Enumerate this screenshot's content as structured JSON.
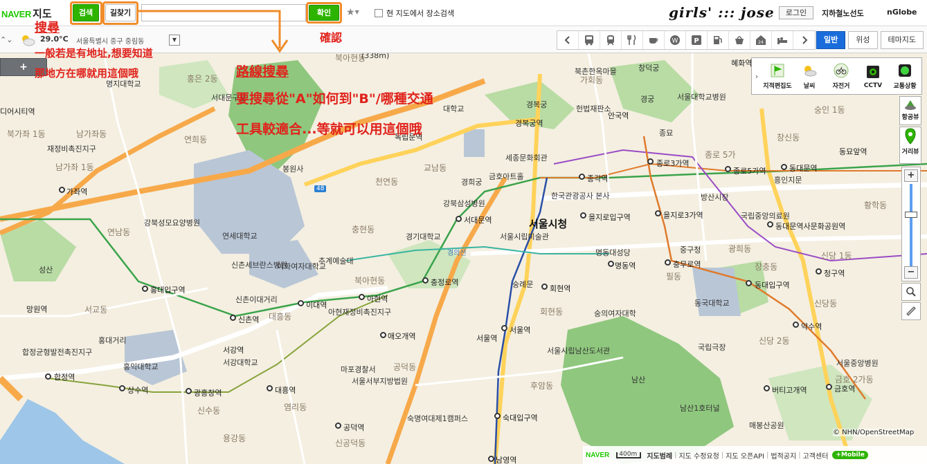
{
  "header": {
    "logo_naver": "NAVER",
    "logo_map": "지도",
    "search_button": "검색",
    "route_button": "길찾기",
    "search_value": "",
    "confirm_button": "확인",
    "nearby_search_label": "현 지도에서 장소검색",
    "blog_signature": "girls' ::: jose",
    "login_button": "로그인",
    "subway_link": "지하철노선도",
    "nglobe_link": "nGlobe"
  },
  "subbar": {
    "temperature": "29.0°C",
    "location": "서울특별시 중구 중림동",
    "tabs": [
      {
        "label": "일반",
        "active": true
      },
      {
        "label": "위성",
        "active": false
      },
      {
        "label": "테마지도",
        "active": false
      }
    ],
    "poi_icons": [
      "prev-arrow-icon",
      "bus-icon",
      "subway-icon",
      "restaurant-icon",
      "cafe-icon",
      "bank-icon",
      "parking-icon",
      "gas-station-icon",
      "shopping-icon",
      "convenience-store-icon",
      "hotel-icon",
      "next-arrow-icon"
    ]
  },
  "map": {
    "add_button": "+",
    "layers": [
      {
        "label": "지적편집도",
        "icon": "cadastral-flag-icon"
      },
      {
        "label": "날씨",
        "icon": "weather-icon"
      },
      {
        "label": "자전거",
        "icon": "bicycle-icon"
      },
      {
        "label": "CCTV",
        "icon": "cctv-icon"
      },
      {
        "label": "교통상황",
        "icon": "traffic-light-icon"
      }
    ],
    "aerial_view": "항공뷰",
    "street_view": "거리뷰",
    "big_label": "서울시청",
    "labels": [
      {
        "t": "북아현동",
        "c": "dong"
      },
      {
        "t": "혜화역",
        "c": "station"
      },
      {
        "t": "명지대학교",
        "c": ""
      },
      {
        "t": "홍은 2동",
        "c": "dong"
      },
      {
        "t": "서대문구청",
        "c": ""
      },
      {
        "t": "북촌한옥마을",
        "c": ""
      },
      {
        "t": "창덕궁",
        "c": ""
      },
      {
        "t": "가회동",
        "c": "dong"
      },
      {
        "t": "디어시티역",
        "c": "station"
      },
      {
        "t": "대학교",
        "c": ""
      },
      {
        "t": "경복궁",
        "c": ""
      },
      {
        "t": "헌법재판소",
        "c": ""
      },
      {
        "t": "서울대학교병원",
        "c": ""
      },
      {
        "t": "경궁",
        "c": ""
      },
      {
        "t": "숭인 1동",
        "c": "dong"
      },
      {
        "t": "북가좌 1동",
        "c": "dong"
      },
      {
        "t": "연희동",
        "c": "dong"
      },
      {
        "t": "안국역",
        "c": "station"
      },
      {
        "t": "경복궁역",
        "c": "station"
      },
      {
        "t": "종묘",
        "c": ""
      },
      {
        "t": "남가좌동",
        "c": "dong"
      },
      {
        "t": "재정비촉진지구",
        "c": ""
      },
      {
        "t": "독립문역",
        "c": "station"
      },
      {
        "t": "창신동",
        "c": "dong"
      },
      {
        "t": "남가좌 1동",
        "c": "dong"
      },
      {
        "t": "봉원사",
        "c": ""
      },
      {
        "t": "세종문화회관",
        "c": ""
      },
      {
        "t": "종로3가역",
        "c": "station"
      },
      {
        "t": "종로 5가",
        "c": "dong"
      },
      {
        "t": "동묘앞역",
        "c": "station"
      },
      {
        "t": "가좌역",
        "c": "station"
      },
      {
        "t": "교남동",
        "c": "dong"
      },
      {
        "t": "경희궁",
        "c": ""
      },
      {
        "t": "금호아트홀",
        "c": ""
      },
      {
        "t": "종각역",
        "c": "station"
      },
      {
        "t": "종로5가역",
        "c": "station"
      },
      {
        "t": "동대문역",
        "c": "station"
      },
      {
        "t": "흥인지문",
        "c": ""
      },
      {
        "t": "천연동",
        "c": "dong"
      },
      {
        "t": "강북삼성병원",
        "c": ""
      },
      {
        "t": "한국관광공사 본사",
        "c": ""
      },
      {
        "t": "방산시장",
        "c": ""
      },
      {
        "t": "황학동",
        "c": "dong"
      },
      {
        "t": "강북성모요양병원",
        "c": ""
      },
      {
        "t": "서대문역",
        "c": "station"
      },
      {
        "t": "을지로입구역",
        "c": "station"
      },
      {
        "t": "을지로3가역",
        "c": "station"
      },
      {
        "t": "국립중앙의료원",
        "c": ""
      },
      {
        "t": "동대문역사문화공원역",
        "c": "station"
      },
      {
        "t": "충현동",
        "c": "dong"
      },
      {
        "t": "연세대학교",
        "c": ""
      },
      {
        "t": "경기대학교",
        "c": ""
      },
      {
        "t": "서울시립미술관",
        "c": ""
      },
      {
        "t": "중구청",
        "c": ""
      },
      {
        "t": "광희동",
        "c": "dong"
      },
      {
        "t": "연남동",
        "c": "dong"
      },
      {
        "t": "신촌세브란스병원",
        "c": ""
      },
      {
        "t": "이화여자대학교",
        "c": ""
      },
      {
        "t": "추계예술대",
        "c": ""
      },
      {
        "t": "명동대성당",
        "c": ""
      },
      {
        "t": "명동역",
        "c": "station"
      },
      {
        "t": "충무로역",
        "c": "station"
      },
      {
        "t": "장충동",
        "c": "dong"
      },
      {
        "t": "신당 1동",
        "c": "dong"
      },
      {
        "t": "청구역",
        "c": "station"
      },
      {
        "t": "성산",
        "c": ""
      },
      {
        "t": "홍대입구역",
        "c": "station"
      },
      {
        "t": "북아현동",
        "c": "dong"
      },
      {
        "t": "충정로역",
        "c": "station"
      },
      {
        "t": "숭례문",
        "c": ""
      },
      {
        "t": "회현역",
        "c": "station"
      },
      {
        "t": "필동",
        "c": "dong"
      },
      {
        "t": "동대입구역",
        "c": "station"
      },
      {
        "t": "동국대학교",
        "c": ""
      },
      {
        "t": "망원역",
        "c": "station"
      },
      {
        "t": "신촌이대거리",
        "c": ""
      },
      {
        "t": "이대역",
        "c": "station"
      },
      {
        "t": "아현역",
        "c": "station"
      },
      {
        "t": "회현동",
        "c": "dong"
      },
      {
        "t": "숭의여자대학",
        "c": ""
      },
      {
        "t": "신당동",
        "c": "dong"
      },
      {
        "t": "서교동",
        "c": "dong"
      },
      {
        "t": "신촌역",
        "c": "station"
      },
      {
        "t": "대흥동",
        "c": "dong"
      },
      {
        "t": "아현재정비촉진지구",
        "c": ""
      },
      {
        "t": "서울역",
        "c": "station"
      },
      {
        "t": "약수역",
        "c": "station"
      },
      {
        "t": "홍대거리",
        "c": ""
      },
      {
        "t": "애오개역",
        "c": "station"
      },
      {
        "t": "서울시립남산도서관",
        "c": ""
      },
      {
        "t": "국립극장",
        "c": ""
      },
      {
        "t": "신당 2동",
        "c": "dong"
      },
      {
        "t": "합정균형발전촉진지구",
        "c": ""
      },
      {
        "t": "서강역",
        "c": "station"
      },
      {
        "t": "서강대학교",
        "c": ""
      },
      {
        "t": "마포경찰서",
        "c": ""
      },
      {
        "t": "서울서부지방법원",
        "c": ""
      },
      {
        "t": "공덕동",
        "c": "dong"
      },
      {
        "t": "후암동",
        "c": "dong"
      },
      {
        "t": "남산",
        "c": ""
      },
      {
        "t": "합정역",
        "c": "station"
      },
      {
        "t": "홍익대학교",
        "c": ""
      },
      {
        "t": "대흥역",
        "c": "station"
      },
      {
        "t": "상수역",
        "c": "station"
      },
      {
        "t": "광흥창역",
        "c": "station"
      },
      {
        "t": "버티고개역",
        "c": "station"
      },
      {
        "t": "금호역",
        "c": "station"
      },
      {
        "t": "서울중앙병원",
        "c": ""
      },
      {
        "t": "금호 2가동",
        "c": "dong"
      },
      {
        "t": "염리동",
        "c": "dong"
      },
      {
        "t": "신수동",
        "c": "dong"
      },
      {
        "t": "공덕역",
        "c": "station"
      },
      {
        "t": "숙명여대제1캠퍼스",
        "c": ""
      },
      {
        "t": "숙대입구역",
        "c": "station"
      },
      {
        "t": "남산1호터널",
        "c": ""
      },
      {
        "t": "매봉산공원",
        "c": ""
      },
      {
        "t": "용강동",
        "c": "dong"
      },
      {
        "t": "신공덕동",
        "c": "dong"
      },
      {
        "t": "남영역",
        "c": "station"
      },
      {
        "t": "서울역",
        "c": "station"
      }
    ],
    "line_labels": [
      "경의선",
      "48",
      "(338m)"
    ]
  },
  "annotations": {
    "search_title": "搜尋",
    "search_desc_1": "一般若是有地址,想要知道",
    "search_desc_2": "那地方在哪就用這個哦",
    "confirm": "確認",
    "route_title": "路線搜尋",
    "route_desc_1": "要搜尋從\"A\"如何到\"B\"/哪種交通",
    "route_desc_2": "工具較適合...等就可以用這個哦"
  },
  "footer": {
    "naver": "NAVER",
    "scale": "400m",
    "links": [
      "지도범례",
      "지도 수정요청",
      "지도 오픈API",
      "법적공지",
      "고객센터"
    ],
    "mobile": "+Mobile",
    "copyright": "© NHN/OpenStreetMap"
  },
  "colors": {
    "naver_green": "#2db400",
    "annotation_red": "#e0221b",
    "annotation_orange": "#f08c2a",
    "tab_active_blue": "#1a6cdb"
  }
}
